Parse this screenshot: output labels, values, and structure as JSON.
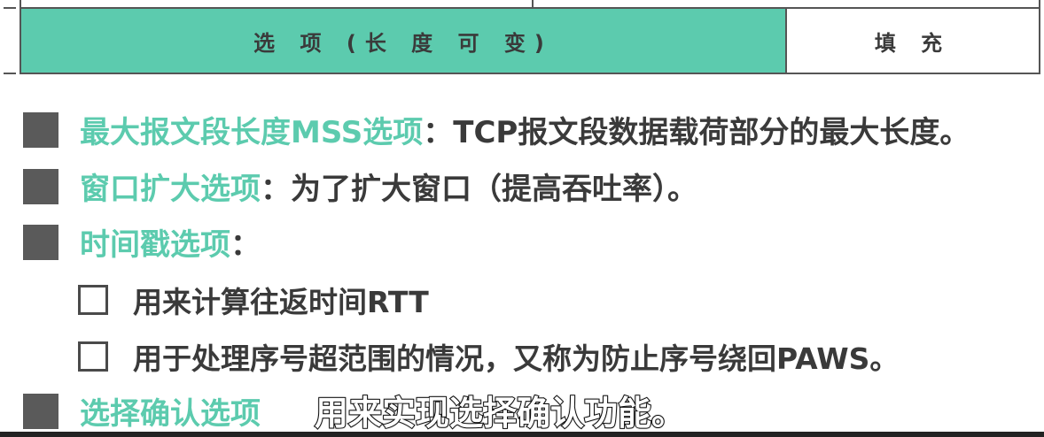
{
  "header": {
    "options_label": "选 项 (长 度 可 变)",
    "padding_label": "填 充"
  },
  "items": [
    {
      "title": "最大报文段长度MSS选项",
      "desc": "：TCP报文段数据载荷部分的最大长度。"
    },
    {
      "title": "窗口扩大选项",
      "desc": "：为了扩大窗口（提高吞吐率）。"
    },
    {
      "title": "时间戳选项",
      "desc": "："
    },
    {
      "title": "选择确认选项",
      "desc": ""
    }
  ],
  "subitems": [
    {
      "text": "用来计算往返时间RTT"
    },
    {
      "text": "用于处理序号超范围的情况，又称为防止序号绕回PAWS。"
    }
  ],
  "subtitle": "用来实现选择确认功能。",
  "colors": {
    "accent": "#5ccbae",
    "text": "#3a3a3a",
    "bullet": "#5a5a5a"
  }
}
